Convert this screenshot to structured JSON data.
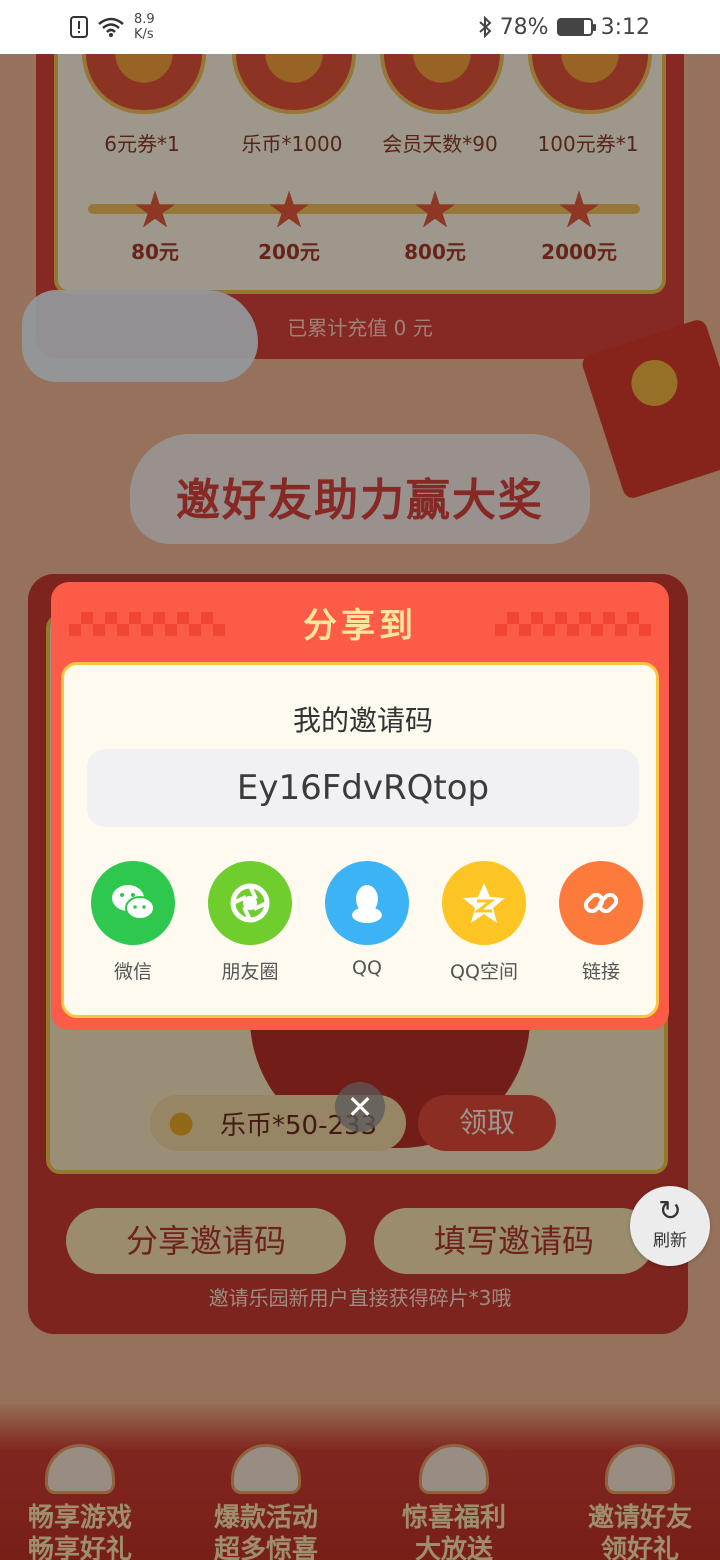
{
  "status_bar": {
    "net_speed_value": "8.9",
    "net_speed_unit": "K/s",
    "battery": "78%",
    "time": "3:12",
    "battery_level": 0.78
  },
  "rewards": [
    {
      "label": "6元券*1"
    },
    {
      "label": "乐币*1000"
    },
    {
      "label": "会员天数*90"
    },
    {
      "label": "100元券*1"
    }
  ],
  "tiers": [
    "80元",
    "200元",
    "800元",
    "2000元"
  ],
  "recharge_text": "已累计充值 0 元",
  "section_title": "邀好友助力赢大奖",
  "coin_reward": "乐币*50-233",
  "claim_label": "领取",
  "share_code_button": "分享邀请码",
  "fill_code_button": "填写邀请码",
  "invite_hint": "邀请乐园新用户直接获得碎片*3哦",
  "refresh_label": "刷新",
  "bottom_nav": [
    {
      "line1": "畅享游戏",
      "line2": "畅享好礼"
    },
    {
      "line1": "爆款活动",
      "line2": "超多惊喜"
    },
    {
      "line1": "惊喜福利",
      "line2": "大放送"
    },
    {
      "line1": "邀请好友",
      "line2": "领好礼"
    }
  ],
  "dialog": {
    "title": "分享到",
    "code_label": "我的邀请码",
    "code_value": "Ey16FdvRQtop",
    "options": [
      {
        "label": "微信",
        "icon": "wechat-icon",
        "color": "#2dc84d"
      },
      {
        "label": "朋友圈",
        "icon": "moments-icon",
        "color": "#6fce2e"
      },
      {
        "label": "QQ",
        "icon": "qq-icon",
        "color": "#3bb3f5"
      },
      {
        "label": "QQ空间",
        "icon": "qzone-icon",
        "color": "#fcc524"
      },
      {
        "label": "链接",
        "icon": "link-icon",
        "color": "#fb7a3c"
      }
    ]
  },
  "colors": {
    "dialog_bg": "#fb5b47",
    "dialog_title": "#ffe59a",
    "accent_red": "#d8433a"
  }
}
